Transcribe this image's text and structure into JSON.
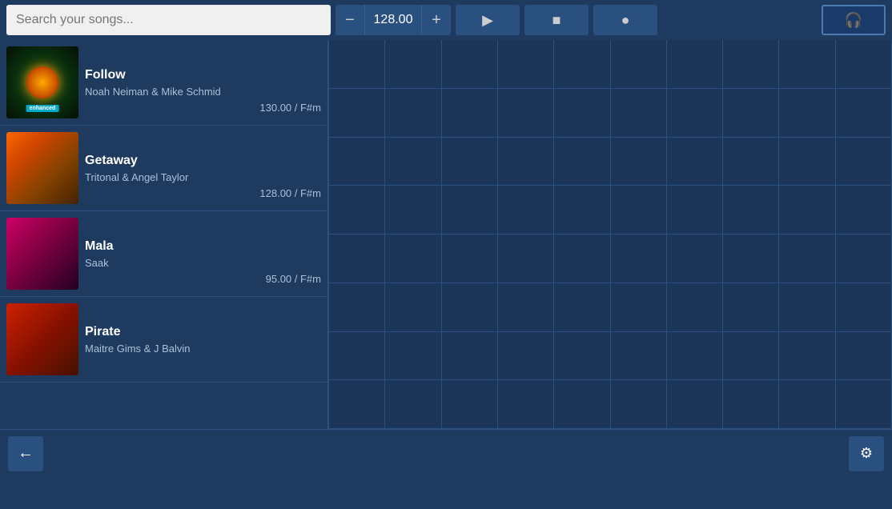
{
  "search": {
    "placeholder": "Search your songs..."
  },
  "bpm": {
    "minus_label": "−",
    "value": "128.00",
    "plus_label": "+"
  },
  "transport": {
    "play_label": "▶",
    "stop_label": "■",
    "record_label": "●",
    "headphone_label": "🎧"
  },
  "songs": [
    {
      "title": "Follow",
      "artist": "Noah Neiman & Mike Schmid",
      "bpm": "130.00",
      "key": "F#m",
      "thumb_class": "thumb-follow",
      "enhanced": "enhanced"
    },
    {
      "title": "Getaway",
      "artist": "Tritonal & Angel Taylor",
      "bpm": "128.00",
      "key": "F#m",
      "thumb_class": "thumb-getaway",
      "enhanced": ""
    },
    {
      "title": "Mala",
      "artist": "Saak",
      "bpm": "95.00",
      "key": "F#m",
      "thumb_class": "thumb-mala",
      "enhanced": ""
    },
    {
      "title": "Pirate",
      "artist": "Maitre Gims & J Balvin",
      "bpm": "",
      "key": "",
      "thumb_class": "thumb-pirate",
      "enhanced": ""
    }
  ],
  "bottom": {
    "back_label": "←",
    "settings_label": "⚙"
  }
}
